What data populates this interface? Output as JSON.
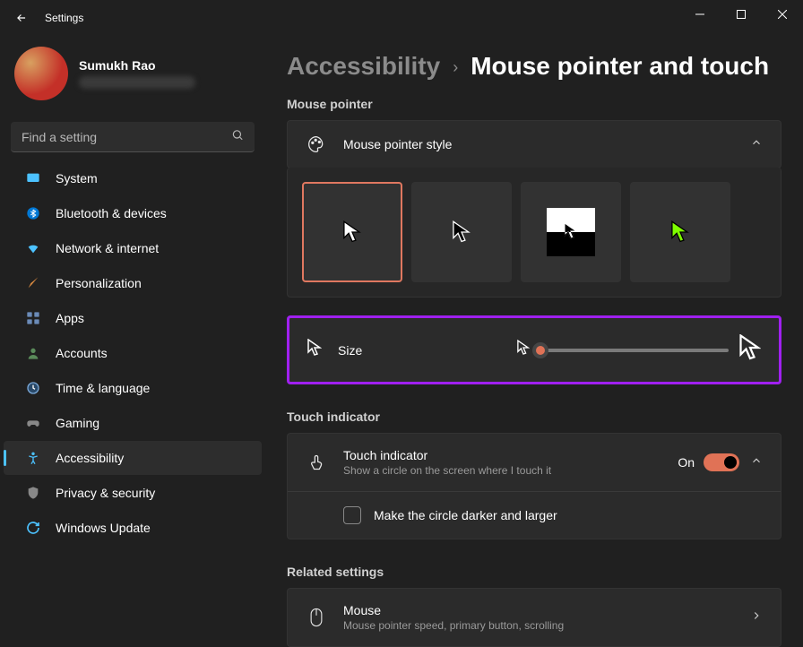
{
  "window": {
    "title": "Settings"
  },
  "user": {
    "name": "Sumukh Rao"
  },
  "search": {
    "placeholder": "Find a setting"
  },
  "nav": {
    "items": [
      {
        "label": "System"
      },
      {
        "label": "Bluetooth & devices"
      },
      {
        "label": "Network & internet"
      },
      {
        "label": "Personalization"
      },
      {
        "label": "Apps"
      },
      {
        "label": "Accounts"
      },
      {
        "label": "Time & language"
      },
      {
        "label": "Gaming"
      },
      {
        "label": "Accessibility"
      },
      {
        "label": "Privacy & security"
      },
      {
        "label": "Windows Update"
      }
    ],
    "activeIndex": 8
  },
  "breadcrumb": {
    "parent": "Accessibility",
    "current": "Mouse pointer and touch"
  },
  "sections": {
    "mouse_pointer": {
      "title": "Mouse pointer",
      "style_label": "Mouse pointer style",
      "size_label": "Size",
      "selected_style": 0
    },
    "touch": {
      "title": "Touch indicator",
      "row_label": "Touch indicator",
      "row_sub": "Show a circle on the screen where I touch it",
      "toggle_state": "On",
      "checkbox_label": "Make the circle darker and larger"
    },
    "related": {
      "title": "Related settings",
      "mouse_label": "Mouse",
      "mouse_sub": "Mouse pointer speed, primary button, scrolling"
    }
  }
}
